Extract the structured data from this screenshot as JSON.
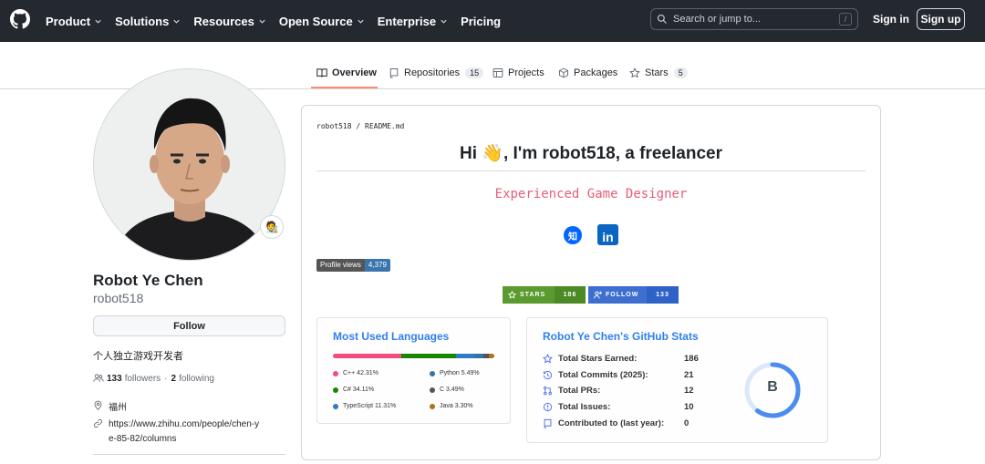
{
  "header": {
    "nav": [
      {
        "label": "Product",
        "dropdown": true
      },
      {
        "label": "Solutions",
        "dropdown": true
      },
      {
        "label": "Resources",
        "dropdown": true
      },
      {
        "label": "Open Source",
        "dropdown": true
      },
      {
        "label": "Enterprise",
        "dropdown": true
      },
      {
        "label": "Pricing",
        "dropdown": false
      }
    ],
    "search_placeholder": "Search or jump to...",
    "search_shortcut": "/",
    "sign_in": "Sign in",
    "sign_up": "Sign up"
  },
  "tabs": [
    {
      "label": "Overview",
      "count": null,
      "icon": "book-icon",
      "active": true
    },
    {
      "label": "Repositories",
      "count": "15",
      "icon": "repo-icon",
      "active": false
    },
    {
      "label": "Projects",
      "count": null,
      "icon": "table-icon",
      "active": false
    },
    {
      "label": "Packages",
      "count": null,
      "icon": "package-icon",
      "active": false
    },
    {
      "label": "Stars",
      "count": "5",
      "icon": "star-icon",
      "active": false
    }
  ],
  "profile": {
    "avatar_badge_emoji": "🧑‍🎨",
    "full_name": "Robot Ye Chen",
    "username": "robot518",
    "follow_label": "Follow",
    "bio": "个人独立游戏开发者",
    "followers_count": "133",
    "followers_label": "followers",
    "separator": "·",
    "following_count": "2",
    "following_label": "following",
    "location": "福州",
    "website": "https://www.zhihu.com/people/chen-ye-85-82/columns"
  },
  "readme": {
    "path_user": "robot518",
    "path_sep": "/",
    "path_file": "README.md",
    "heading_before": "Hi ",
    "heading_emoji": "👋",
    "heading_after": ", I'm robot518, a freelancer",
    "subtitle": "Experienced Game Designer",
    "zhihu_icon_text": "知",
    "linkedin_icon_text": "in",
    "profile_views_label": "Profile views",
    "profile_views_value": "4,379",
    "stars_badge_label": "STARS",
    "stars_badge_value": "186",
    "follow_badge_label": "FOLLOW",
    "follow_badge_value": "133"
  },
  "languages_card": {
    "title": "Most Used Languages",
    "languages": [
      {
        "name": "C++",
        "percent": 42.31,
        "label": "C++ 42.31%",
        "color": "#f34b7d"
      },
      {
        "name": "C#",
        "percent": 34.11,
        "label": "C# 34.11%",
        "color": "#178600"
      },
      {
        "name": "TypeScript",
        "percent": 11.31,
        "label": "TypeScript 11.31%",
        "color": "#3178c6"
      },
      {
        "name": "Python",
        "percent": 5.49,
        "label": "Python 5.49%",
        "color": "#3572A5"
      },
      {
        "name": "C",
        "percent": 3.49,
        "label": "C 3.49%",
        "color": "#555555"
      },
      {
        "name": "Java",
        "percent": 3.3,
        "label": "Java 3.30%",
        "color": "#b07219"
      }
    ]
  },
  "stats_card": {
    "title": "Robot Ye Chen's GitHub Stats",
    "rows": [
      {
        "label": "Total Stars Earned:",
        "value": "186",
        "icon": "star-icon"
      },
      {
        "label": "Total Commits (2025):",
        "value": "21",
        "icon": "history-icon"
      },
      {
        "label": "Total PRs:",
        "value": "12",
        "icon": "pull-request-icon"
      },
      {
        "label": "Total Issues:",
        "value": "10",
        "icon": "issue-icon"
      },
      {
        "label": "Contributed to (last year):",
        "value": "0",
        "icon": "repo-icon"
      }
    ],
    "rank": "B",
    "rank_progress": 0.6
  },
  "colors": {
    "header_bg": "#24292f",
    "accent_blue": "#2f80ed",
    "subtitle_pink": "#e85d75",
    "stars_badge": "#5b9a2e",
    "follow_badge": "#3e6fd0"
  }
}
